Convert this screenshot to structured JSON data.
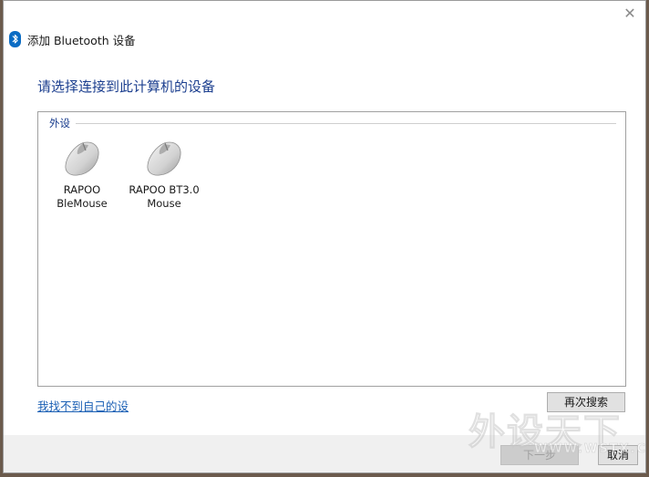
{
  "window": {
    "title": "添加 Bluetooth 设备",
    "close_glyph": "✕",
    "title_icon": "bluetooth-icon"
  },
  "heading": "请选择连接到此计算机的设备",
  "group": {
    "label": "外设"
  },
  "devices": [
    {
      "name_line1": "RAPOO",
      "name_line2": "BleMouse",
      "icon": "mouse-icon"
    },
    {
      "name_line1": "RAPOO BT3.0",
      "name_line2": "Mouse",
      "icon": "mouse-icon"
    }
  ],
  "link_text": "我找不到自己的设",
  "buttons": {
    "rescan": "再次搜索",
    "next": "下一步",
    "cancel": "取消"
  },
  "watermark": {
    "big": "外设天下",
    "small": "WWW.WSTX.COM"
  },
  "colors": {
    "heading": "#1c3f8f",
    "link": "#1a5fb4",
    "bluetooth": "#0a6cc4"
  }
}
